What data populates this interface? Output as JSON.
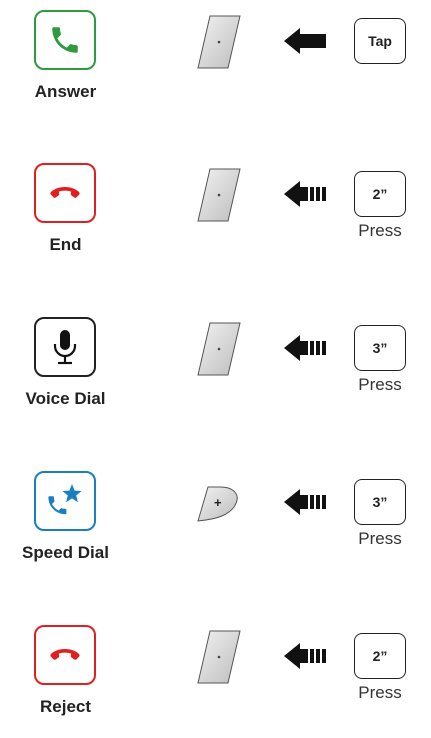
{
  "rows": [
    {
      "label": "Answer",
      "key": "Tap",
      "caption": "",
      "color": "#2e9b3e",
      "icon": "phone-answer-icon",
      "button": "slash-button-icon",
      "arrow": "solid-arrow-left-icon"
    },
    {
      "label": "End",
      "key": "2”",
      "caption": "Press",
      "color": "#e02020",
      "icon": "phone-hangup-icon",
      "button": "slash-button-icon",
      "arrow": "striped-arrow-left-icon"
    },
    {
      "label": "Voice Dial",
      "key": "3”",
      "caption": "Press",
      "color": "#222222",
      "icon": "microphone-icon",
      "button": "slash-button-icon",
      "arrow": "striped-arrow-left-icon"
    },
    {
      "label": "Speed Dial",
      "key": "3”",
      "caption": "Press",
      "color": "#1a7fc1",
      "icon": "speed-dial-phone-star-icon",
      "button": "plus-button-icon",
      "arrow": "striped-arrow-left-icon"
    },
    {
      "label": "Reject",
      "key": "2”",
      "caption": "Press",
      "color": "#e02020",
      "icon": "phone-hangup-icon",
      "button": "slash-button-icon",
      "arrow": "striped-arrow-left-icon"
    }
  ]
}
